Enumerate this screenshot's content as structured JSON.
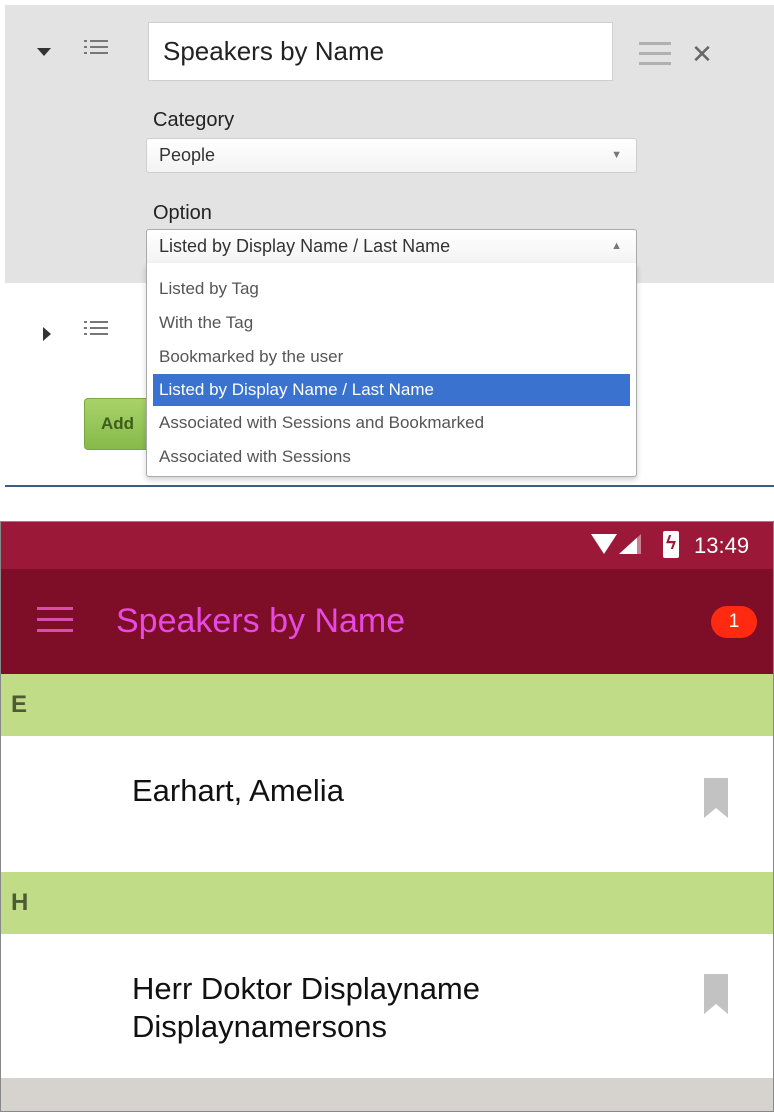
{
  "editor": {
    "title_value": "Speakers by Name",
    "category_label": "Category",
    "category_value": "People",
    "option_label": "Option",
    "option_value": "Listed by Display Name / Last Name",
    "options": [
      "Listed by Tag",
      "With the Tag",
      "Bookmarked by the user",
      "Listed by Display Name / Last Name",
      "Associated with Sessions and Bookmarked",
      "Associated with Sessions"
    ],
    "selected_option_index": 3,
    "add_button_label": "Add",
    "colors": {
      "selected": "#3a72d0",
      "add_button": "#8fc250"
    }
  },
  "phone": {
    "status": {
      "time": "13:49",
      "icons": [
        "wifi-icon",
        "signal-icon",
        "battery-charging-icon"
      ]
    },
    "app_title": "Speakers by Name",
    "notification_count": "1",
    "sections": [
      {
        "letter": "E",
        "speakers": [
          "Earhart, Amelia"
        ]
      },
      {
        "letter": "H",
        "speakers": [
          "Herr Doktor Displayname Displaynamersons"
        ]
      }
    ],
    "colors": {
      "status_bar": "#9b1839",
      "app_bar": "#7e0e27",
      "title": "#e64ae0",
      "section": "#c1dc86",
      "badge": "#ff2a10"
    }
  }
}
